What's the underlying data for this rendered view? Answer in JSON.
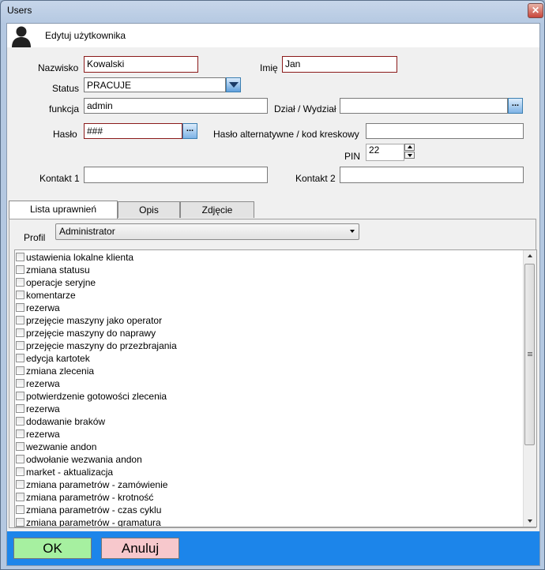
{
  "window": {
    "title": "Users",
    "close_glyph": "✕"
  },
  "header": {
    "title": "Edytuj użytkownika",
    "icon": "user-icon"
  },
  "form": {
    "nazwisko_label": "Nazwisko",
    "nazwisko_value": "Kowalski",
    "imie_label": "Imię",
    "imie_value": "Jan",
    "status_label": "Status",
    "status_value": "PRACUJE",
    "funkcja_label": "funkcja",
    "funkcja_value": "admin",
    "dzial_label": "Dział / Wydział",
    "dzial_value": "",
    "haslo_label": "Hasło",
    "haslo_value": "###",
    "haslo_alt_label": "Hasło alternatywne / kod kreskowy",
    "haslo_alt_value": "",
    "pin_label": "PIN",
    "pin_value": "22",
    "kontakt1_label": "Kontakt 1",
    "kontakt1_value": "",
    "kontakt2_label": "Kontakt 2",
    "kontakt2_value": "",
    "browse_glyph": "..."
  },
  "tabs": [
    {
      "label": "Lista uprawnień",
      "active": true
    },
    {
      "label": "Opis",
      "active": false
    },
    {
      "label": "Zdjęcie",
      "active": false
    }
  ],
  "profil": {
    "label": "Profil",
    "value": "Administrator"
  },
  "permissions": [
    "ustawienia lokalne klienta",
    "zmiana statusu",
    "operacje seryjne",
    "komentarze",
    "rezerwa",
    "przejęcie maszyny jako operator",
    "przejęcie maszyny do naprawy",
    "przejęcie maszyny do przezbrajania",
    "edycja kartotek",
    "zmiana zlecenia",
    "rezerwa",
    "potwierdzenie gotowości zlecenia",
    "rezerwa",
    "dodawanie braków",
    "rezerwa",
    "wezwanie andon",
    "odwołanie wezwania andon",
    "market - aktualizacja",
    "zmiana parametrów - zamówienie",
    "zmiana parametrów - krotność",
    "zmiana parametrów - czas cyklu",
    "zmiana parametrów - gramatura"
  ],
  "buttons": {
    "ok_label": "OK",
    "cancel_label": "Anuluj"
  },
  "colors": {
    "footer": "#1c85ea",
    "ok": "#a6f0a0",
    "cancel": "#f7c8cc",
    "accent_border": "#8b1a1a"
  }
}
